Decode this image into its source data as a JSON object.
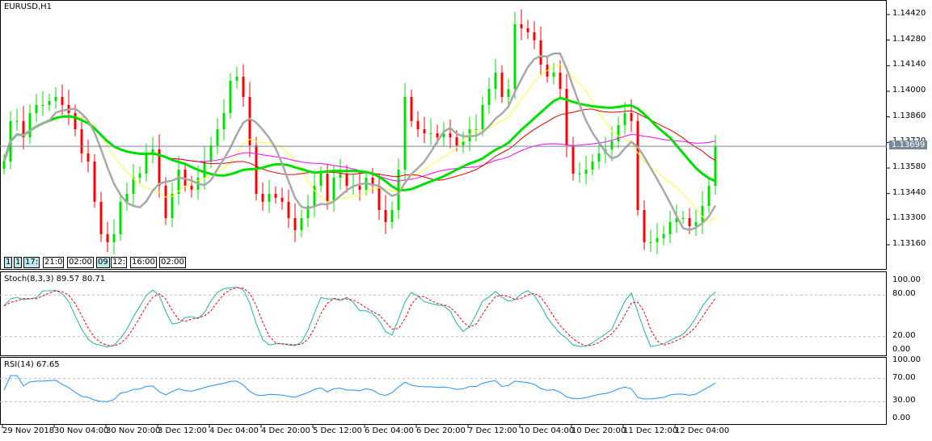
{
  "symbol_label": "EURUSD,H1",
  "stoch_label": "Stoch(8,3,3) 89.57 80.71",
  "rsi_label": "RSI(14) 67.65",
  "current_price": "1.13699",
  "time_tags": [
    "1",
    "1",
    "17:",
    "21:0",
    "02:00",
    "09",
    "12:",
    "16:00",
    "02:00"
  ],
  "colors": {
    "bull": "#00e000",
    "bear": "#ff0000",
    "ma_green": "#00e000",
    "ma_gray": "#a8a8a8",
    "ma_yellow": "#ffff33",
    "ma_red": "#dd0000",
    "ma_magenta": "#ff00ff",
    "stoch_main": "#20b2aa",
    "stoch_signal": "#ff0000",
    "rsi": "#1e90ff",
    "price_line": "#778899"
  },
  "chart_data": {
    "type": "candlestick",
    "title": "EURUSD,H1",
    "price_axis": {
      "ticks": [
        "1.14420",
        "1.14280",
        "1.14140",
        "1.14000",
        "1.13860",
        "1.13720",
        "1.13580",
        "1.13440",
        "1.13300",
        "1.13160"
      ],
      "range": [
        1.1306,
        1.145
      ]
    },
    "stoch_axis": {
      "ticks": [
        "100.00",
        "80.00",
        "20.00",
        "0.00"
      ]
    },
    "rsi_axis": {
      "ticks": [
        "100.00",
        "70.00",
        "30.00",
        "0.00"
      ]
    },
    "time_labels": [
      "29 Nov 2018",
      "30 Nov 04:00",
      "30 Nov 20:00",
      "3 Dec 12:00",
      "4 Dec 04:00",
      "4 Dec 20:00",
      "5 Dec 12:00",
      "6 Dec 04:00",
      "6 Dec 20:00",
      "7 Dec 12:00",
      "10 Dec 04:00",
      "10 Dec 20:00",
      "11 Dec 12:00",
      "12 Dec 04:00"
    ],
    "closes": [
      1.13616,
      1.13837,
      1.13837,
      1.13748,
      1.13881,
      1.13925,
      1.13925,
      1.13947,
      1.13969,
      1.13925,
      1.13881,
      1.13792,
      1.1366,
      1.13616,
      1.13395,
      1.13218,
      1.13174,
      1.13218,
      1.13395,
      1.13439,
      1.13527,
      1.13549,
      1.1366,
      1.13682,
      1.13483,
      1.13306,
      1.13439,
      1.13571,
      1.13483,
      1.13461,
      1.13527,
      1.13616,
      1.13704,
      1.13792,
      1.13881,
      1.14058,
      1.1408,
      1.13969,
      1.13704,
      1.13439,
      1.13395,
      1.13439,
      1.13417,
      1.13395,
      1.13306,
      1.1324,
      1.13306,
      1.13372,
      1.13483,
      1.13549,
      1.13395,
      1.13527,
      1.13549,
      1.13483,
      1.13483,
      1.13461,
      1.13527,
      1.13483,
      1.1335,
      1.13284,
      1.1335,
      1.13571,
      1.13969,
      1.13837,
      1.13792,
      1.1377,
      1.1377,
      1.13748,
      1.1377,
      1.13748,
      1.13704,
      1.13726,
      1.13792,
      1.13792,
      1.13925,
      1.14013,
      1.14102,
      1.13969,
      1.14013,
      1.14367,
      1.14345,
      1.14323,
      1.14279,
      1.14146,
      1.1408,
      1.14102,
      1.14013,
      1.13704,
      1.13549,
      1.13549,
      1.13571,
      1.13616,
      1.1366,
      1.13682,
      1.13726,
      1.13814,
      1.13881,
      1.13837,
      1.1335,
      1.13174,
      1.13174,
      1.13196,
      1.13218,
      1.13284,
      1.13306,
      1.13306,
      1.13262,
      1.13284,
      1.13372,
      1.13483,
      1.13699
    ],
    "current_price": 1.13699
  }
}
